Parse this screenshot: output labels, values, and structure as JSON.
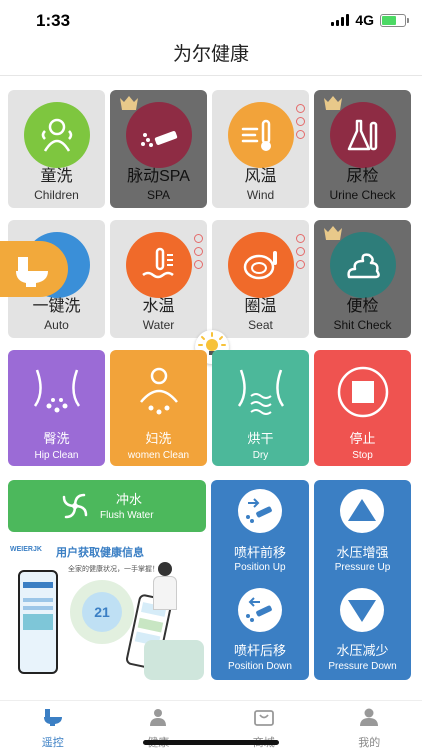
{
  "status": {
    "time": "1:33",
    "network": "4G",
    "battery_level": 0.6
  },
  "header": {
    "title": "为尔健康"
  },
  "modes": [
    {
      "cn": "童洗",
      "en": "Children",
      "icon": "child-icon",
      "color": "#7ec63f",
      "locked": false
    },
    {
      "cn": "脉动SPA",
      "en": "SPA",
      "icon": "spa-icon",
      "color": "#8e2c44",
      "locked": true
    },
    {
      "cn": "风温",
      "en": "Wind",
      "icon": "thermometer-wind-icon",
      "color": "#f2a33a",
      "locked": false
    },
    {
      "cn": "尿检",
      "en": "Urine Check",
      "icon": "flask-icon",
      "color": "#8e2c44",
      "locked": true
    },
    {
      "cn": "一键洗",
      "en": "Auto",
      "icon": "auto-wash-icon",
      "color": "#3a8fd8",
      "locked": false
    },
    {
      "cn": "水温",
      "en": "Water",
      "icon": "water-temp-icon",
      "color": "#f06a2a",
      "locked": false
    },
    {
      "cn": "圈温",
      "en": "Seat",
      "icon": "seat-temp-icon",
      "color": "#f06a2a",
      "locked": false
    },
    {
      "cn": "便检",
      "en": "Shit Check",
      "icon": "stool-icon",
      "color": "#2e7d7a",
      "locked": true
    }
  ],
  "actions": [
    {
      "cn": "臀洗",
      "en": "Hip Clean",
      "color": "#9b6bd6",
      "icon": "hip-clean-icon"
    },
    {
      "cn": "妇洗",
      "en": "women Clean",
      "color": "#f2a33a",
      "icon": "women-clean-icon"
    },
    {
      "cn": "烘干",
      "en": "Dry",
      "color": "#4cb89a",
      "icon": "dry-icon"
    },
    {
      "cn": "停止",
      "en": "Stop",
      "color": "#ef5350",
      "icon": "stop-icon"
    }
  ],
  "flush": {
    "cn": "冲水",
    "en": "Flush Water",
    "color": "#4cb85c"
  },
  "adjust": {
    "position_up": {
      "cn": "喷杆前移",
      "en": "Position Up"
    },
    "position_down": {
      "cn": "喷杆后移",
      "en": "Position Down"
    },
    "pressure_up": {
      "cn": "水压增强",
      "en": "Pressure Up"
    },
    "pressure_down": {
      "cn": "水压减少",
      "en": "Pressure Down"
    }
  },
  "promo": {
    "headline": "用户获取健康信息",
    "brand": "WEIERJK",
    "sub": "全家的健康状况，一手掌握！",
    "badge": "21"
  },
  "tabs": [
    {
      "label": "遥控",
      "icon": "toilet-icon",
      "active": true
    },
    {
      "label": "健康",
      "icon": "doctor-icon",
      "active": false
    },
    {
      "label": "商城",
      "icon": "shop-icon",
      "active": false
    },
    {
      "label": "我的",
      "icon": "profile-icon",
      "active": false
    }
  ]
}
